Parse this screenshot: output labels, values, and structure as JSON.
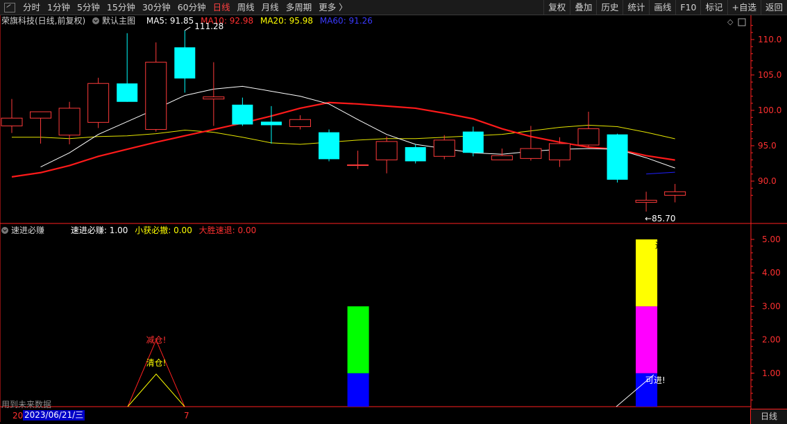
{
  "toolbar": {
    "periods": [
      "分时",
      "1分钟",
      "5分钟",
      "15分钟",
      "30分钟",
      "60分钟",
      "日线",
      "周线",
      "月线",
      "多周期",
      "更多 〉"
    ],
    "active_period": "日线",
    "tools": [
      "复权",
      "叠加",
      "历史",
      "统计",
      "画线",
      "F10",
      "标记",
      "+自选",
      "返回"
    ]
  },
  "main_legend": {
    "stock": "荣旗科技(日线,前复权)",
    "template": "默认主图",
    "ma5": "MA5: 91.85",
    "ma10": "MA10: 92.98",
    "ma20": "MA20: 95.98",
    "ma60": "MA60: 91.26",
    "colors": {
      "ma5": "#ffffff",
      "ma10": "#ff2020",
      "ma20": "#ffff00",
      "ma60": "#2020ff"
    }
  },
  "sub_legend": {
    "name": "速进必赚",
    "v1": "速进必赚: 1.00",
    "v2": "小获必撤: 0.00",
    "v3": "大胜速退: 0.00"
  },
  "price_axis": [
    "110.0",
    "105.0",
    "100.0",
    "95.0",
    "90.0"
  ],
  "indicator_axis": [
    "5.00",
    "4.00",
    "3.00",
    "2.00",
    "1.00"
  ],
  "high_marker": "111.28",
  "low_marker": "←85.70",
  "annotations": {
    "jiancang": "减仓!",
    "qingcang": "清仓!",
    "kejin_low": "可进!",
    "kejin_high": "进!"
  },
  "date_label": "2023/06/21/三",
  "x_label_left": "20",
  "x_label_mid": "7",
  "future_note": "用到未来数据",
  "status": "日线",
  "chart_data": {
    "type": "candlestick",
    "ylim": [
      85,
      112
    ],
    "candles": [
      {
        "o": 97.8,
        "c": 98.9,
        "h": 101.6,
        "l": 96.8
      },
      {
        "o": 98.9,
        "c": 99.8,
        "h": 99.8,
        "l": 95.3
      },
      {
        "o": 96.5,
        "c": 100.3,
        "h": 101.2,
        "l": 95.2
      },
      {
        "o": 98.3,
        "c": 103.8,
        "h": 104.6,
        "l": 97.5
      },
      {
        "o": 103.8,
        "c": 101.2,
        "h": 110.9,
        "l": 101.2
      },
      {
        "o": 97.3,
        "c": 106.8,
        "h": 109.6,
        "l": 97.0
      },
      {
        "o": 108.9,
        "c": 104.5,
        "h": 111.28,
        "l": 102.5
      },
      {
        "o": 101.6,
        "c": 101.9,
        "h": 106.8,
        "l": 97.8
      },
      {
        "o": 100.8,
        "c": 98.0,
        "h": 101.8,
        "l": 97.8
      },
      {
        "o": 98.4,
        "c": 97.9,
        "h": 100.6,
        "l": 95.3
      },
      {
        "o": 97.7,
        "c": 98.7,
        "h": 99.3,
        "l": 97.3
      },
      {
        "o": 96.9,
        "c": 93.1,
        "h": 97.3,
        "l": 92.8
      },
      {
        "o": 92.2,
        "c": 92.3,
        "h": 94.3,
        "l": 91.7
      },
      {
        "o": 93.0,
        "c": 95.6,
        "h": 96.3,
        "l": 91.1
      },
      {
        "o": 94.8,
        "c": 92.8,
        "h": 95.2,
        "l": 92.5
      },
      {
        "o": 93.5,
        "c": 95.8,
        "h": 96.5,
        "l": 93.1
      },
      {
        "o": 97.0,
        "c": 94.0,
        "h": 97.7,
        "l": 93.5
      },
      {
        "o": 93.0,
        "c": 93.6,
        "h": 94.6,
        "l": 93.0
      },
      {
        "o": 93.2,
        "c": 94.6,
        "h": 97.8,
        "l": 92.9
      },
      {
        "o": 93.0,
        "c": 95.3,
        "h": 96.2,
        "l": 92.0
      },
      {
        "o": 95.1,
        "c": 97.4,
        "h": 99.8,
        "l": 94.8
      },
      {
        "o": 96.6,
        "c": 90.2,
        "h": 96.7,
        "l": 89.8
      },
      {
        "o": 87.0,
        "c": 87.3,
        "h": 88.5,
        "l": 85.7
      },
      {
        "o": 88.0,
        "c": 88.5,
        "h": 89.6,
        "l": 87.0
      }
    ],
    "ma5": [
      92.0,
      94.0,
      96.6,
      98.4,
      100.2,
      102.1,
      103.0,
      103.4,
      102.7,
      102.0,
      100.9,
      98.7,
      96.6,
      95.2,
      94.6,
      94.0,
      93.8,
      94.2,
      94.5,
      94.6,
      94.5,
      93.3,
      91.85
    ],
    "ma10": [
      90.6,
      91.2,
      92.2,
      93.5,
      94.5,
      95.5,
      96.4,
      97.3,
      98.2,
      99.2,
      100.3,
      101.1,
      100.9,
      100.6,
      100.3,
      99.6,
      98.8,
      97.4,
      96.3,
      95.5,
      94.8,
      94.5,
      93.6,
      92.98
    ],
    "ma20": [
      96.2,
      96.2,
      96.0,
      96.3,
      96.4,
      96.7,
      97.2,
      96.9,
      96.2,
      95.4,
      95.2,
      95.5,
      95.8,
      96.0,
      96.0,
      96.2,
      96.4,
      96.6,
      97.1,
      97.6,
      97.9,
      97.7,
      96.9,
      95.98
    ],
    "ma60": [
      91.0,
      91.26
    ],
    "indicator": [
      {
        "index": 12,
        "blue": 1,
        "green": 2
      },
      {
        "index": 22,
        "blue": 1,
        "magenta": 2,
        "yellow": 2
      }
    ]
  }
}
